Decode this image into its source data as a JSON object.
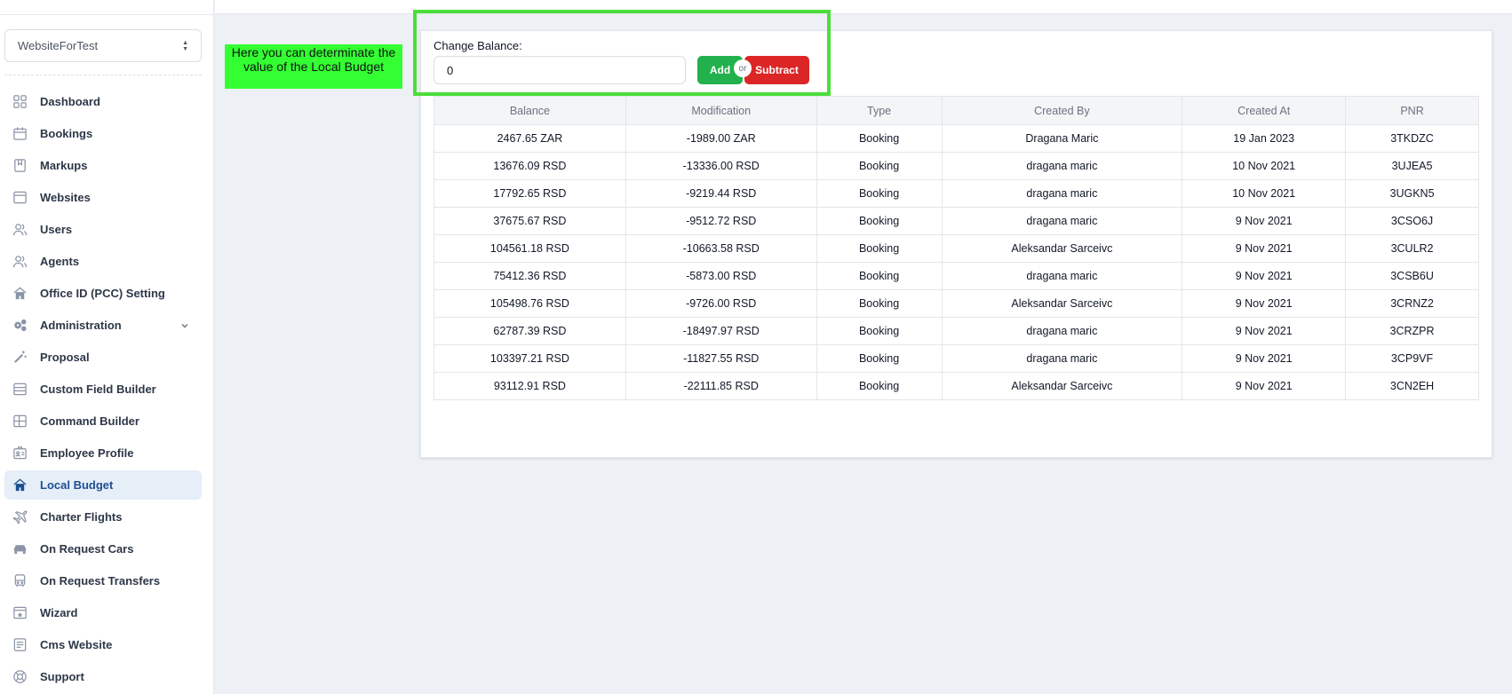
{
  "sidebar": {
    "site_selector": "WebsiteForTest",
    "items": [
      {
        "label": "Dashboard",
        "icon": "grid-icon"
      },
      {
        "label": "Bookings",
        "icon": "calendar-icon"
      },
      {
        "label": "Markups",
        "icon": "bookmark-icon"
      },
      {
        "label": "Websites",
        "icon": "browser-icon"
      },
      {
        "label": "Users",
        "icon": "users-icon"
      },
      {
        "label": "Agents",
        "icon": "users-icon"
      },
      {
        "label": "Office ID (PCC) Setting",
        "icon": "home-icon"
      },
      {
        "label": "Administration",
        "icon": "gears-icon"
      },
      {
        "label": "Proposal",
        "icon": "magic-wand-icon"
      },
      {
        "label": "Custom Field Builder",
        "icon": "list-icon"
      },
      {
        "label": "Command Builder",
        "icon": "layout-icon"
      },
      {
        "label": "Employee Profile",
        "icon": "id-card-icon"
      },
      {
        "label": "Local Budget",
        "icon": "home-icon",
        "active": true
      },
      {
        "label": "Charter Flights",
        "icon": "plane-icon"
      },
      {
        "label": "On Request Cars",
        "icon": "car-icon"
      },
      {
        "label": "On Request Transfers",
        "icon": "bus-icon"
      },
      {
        "label": "Wizard",
        "icon": "window-star-icon"
      },
      {
        "label": "Cms Website",
        "icon": "document-icon"
      },
      {
        "label": "Support",
        "icon": "lifebuoy-icon"
      }
    ]
  },
  "annotation": "Here you can determinate the value of the Local Budget",
  "balance": {
    "label": "Change Balance:",
    "value": "0",
    "add_label": "Add",
    "or_label": "or",
    "subtract_label": "Subtract"
  },
  "table": {
    "headers": [
      "Balance",
      "Modification",
      "Type",
      "Created By",
      "Created At",
      "PNR"
    ],
    "rows": [
      [
        "2467.65 ZAR",
        "-1989.00 ZAR",
        "Booking",
        "Dragana Maric",
        "19 Jan 2023",
        "3TKDZC"
      ],
      [
        "13676.09 RSD",
        "-13336.00 RSD",
        "Booking",
        "dragana maric",
        "10 Nov 2021",
        "3UJEA5"
      ],
      [
        "17792.65 RSD",
        "-9219.44 RSD",
        "Booking",
        "dragana maric",
        "10 Nov 2021",
        "3UGKN5"
      ],
      [
        "37675.67 RSD",
        "-9512.72 RSD",
        "Booking",
        "dragana maric",
        "9 Nov 2021",
        "3CSO6J"
      ],
      [
        "104561.18 RSD",
        "-10663.58 RSD",
        "Booking",
        "Aleksandar Sarceivc",
        "9 Nov 2021",
        "3CULR2"
      ],
      [
        "75412.36 RSD",
        "-5873.00 RSD",
        "Booking",
        "dragana maric",
        "9 Nov 2021",
        "3CSB6U"
      ],
      [
        "105498.76 RSD",
        "-9726.00 RSD",
        "Booking",
        "Aleksandar Sarceivc",
        "9 Nov 2021",
        "3CRNZ2"
      ],
      [
        "62787.39 RSD",
        "-18497.97 RSD",
        "Booking",
        "dragana maric",
        "9 Nov 2021",
        "3CRZPR"
      ],
      [
        "103397.21 RSD",
        "-11827.55 RSD",
        "Booking",
        "dragana maric",
        "9 Nov 2021",
        "3CP9VF"
      ],
      [
        "93112.91 RSD",
        "-22111.85 RSD",
        "Booking",
        "Aleksandar Sarceivc",
        "9 Nov 2021",
        "3CN2EH"
      ]
    ]
  },
  "colors": {
    "add": "#22b14c",
    "subtract": "#dc2626",
    "highlight": "#4ade3a",
    "annotation_bg": "#33ff33",
    "active_item": "#1d4f91"
  }
}
